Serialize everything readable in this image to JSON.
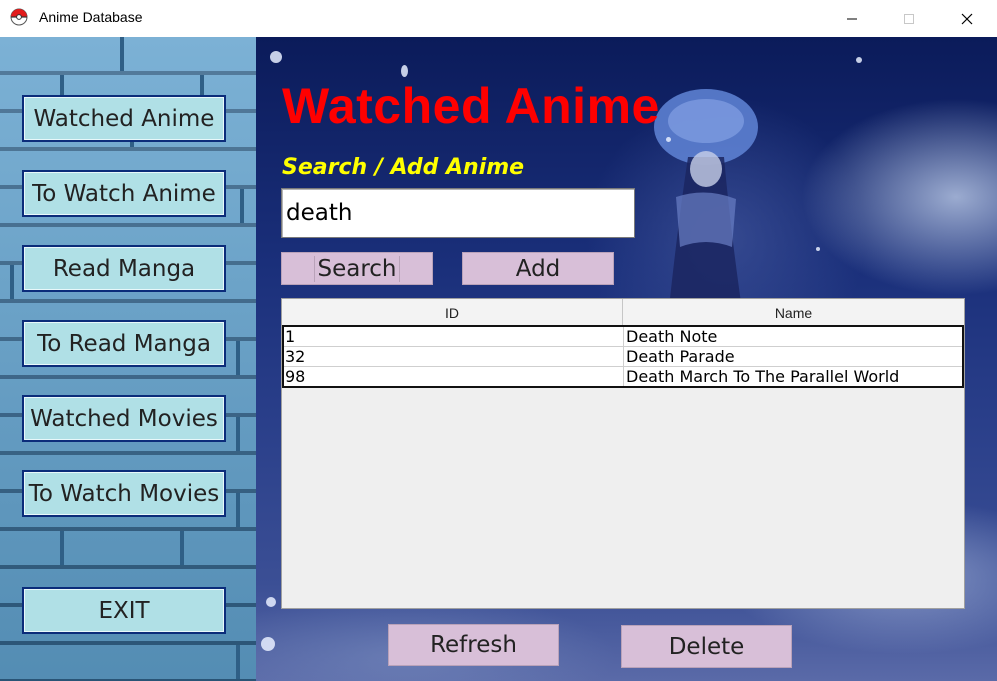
{
  "window": {
    "title": "Anime Database",
    "icon": "pokeball-icon"
  },
  "sidebar": {
    "buttons": [
      {
        "label": "Watched Anime"
      },
      {
        "label": "To Watch Anime"
      },
      {
        "label": "Read Manga"
      },
      {
        "label": "To Read Manga"
      },
      {
        "label": "Watched Movies"
      },
      {
        "label": "To Watch Movies"
      }
    ],
    "exit_label": "EXIT"
  },
  "main": {
    "heading": "Watched Anime",
    "search_label": "Search / Add Anime",
    "search_value": "death",
    "search_button": "Search",
    "add_button": "Add",
    "refresh_button": "Refresh",
    "delete_button": "Delete"
  },
  "table": {
    "columns": [
      "ID",
      "Name"
    ],
    "rows": [
      {
        "id": "1",
        "name": "Death Note"
      },
      {
        "id": "32",
        "name": "Death Parade"
      },
      {
        "id": "98",
        "name": "Death March To The Parallel World"
      }
    ]
  },
  "colors": {
    "heading": "#ff0000",
    "search_label": "#ffff00",
    "sidebar_button": "#b0e0e6",
    "action_button": "#d8bfd8"
  }
}
